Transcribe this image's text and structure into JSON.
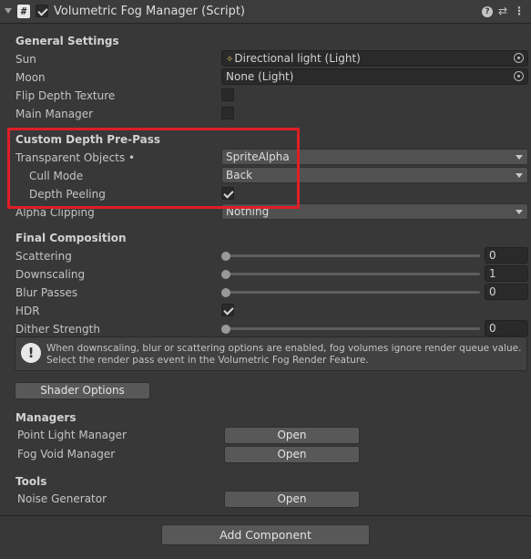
{
  "header": {
    "title": "Volumetric Fog Manager (Script)",
    "script_glyph": "#",
    "enabled": true,
    "icons": [
      "fold-arrow-icon",
      "script-icon",
      "help-icon",
      "preset-icon",
      "menu-icon"
    ],
    "help_glyph": "?",
    "preset_glyph": "⇄",
    "menu_glyph": "⋮"
  },
  "general": {
    "title": "General Settings",
    "sun_label": "Sun",
    "sun_value": "Directional light (Light)",
    "moon_label": "Moon",
    "moon_value": "None (Light)",
    "flip_label": "Flip Depth Texture",
    "flip_checked": false,
    "main_label": "Main Manager",
    "main_checked": false
  },
  "depth": {
    "title": "Custom Depth Pre-Pass",
    "transparent_label": "Transparent Objects •",
    "transparent_value": "SpriteAlpha",
    "cull_label": "Cull Mode",
    "cull_value": "Back",
    "peeling_label": "Depth Peeling",
    "peeling_checked": true,
    "alpha_label": "Alpha Clipping",
    "alpha_value": "Nothing"
  },
  "composition": {
    "title": "Final Composition",
    "scattering_label": "Scattering",
    "scattering_value": "0",
    "downscaling_label": "Downscaling",
    "downscaling_value": "1",
    "blur_label": "Blur Passes",
    "blur_value": "0",
    "hdr_label": "HDR",
    "hdr_checked": true,
    "dither_label": "Dither Strength",
    "dither_value": "0"
  },
  "helpbox": {
    "icon_glyph": "!",
    "text": "When downscaling, blur or scattering options are enabled, fog volumes ignore render queue value. Select the render pass event in the Volumetric Fog Render Feature."
  },
  "shader_button": "Shader Options",
  "managers": {
    "title": "Managers",
    "point_label": "Point Light Manager",
    "point_button": "Open",
    "void_label": "Fog Void Manager",
    "void_button": "Open"
  },
  "tools": {
    "title": "Tools",
    "noise_label": "Noise Generator",
    "noise_button": "Open"
  },
  "add_component": "Add Component",
  "colors": {
    "background": "#383838",
    "highlight_border": "#dd1f26",
    "field_bg": "#2a2a2a",
    "button_bg": "#585858"
  }
}
